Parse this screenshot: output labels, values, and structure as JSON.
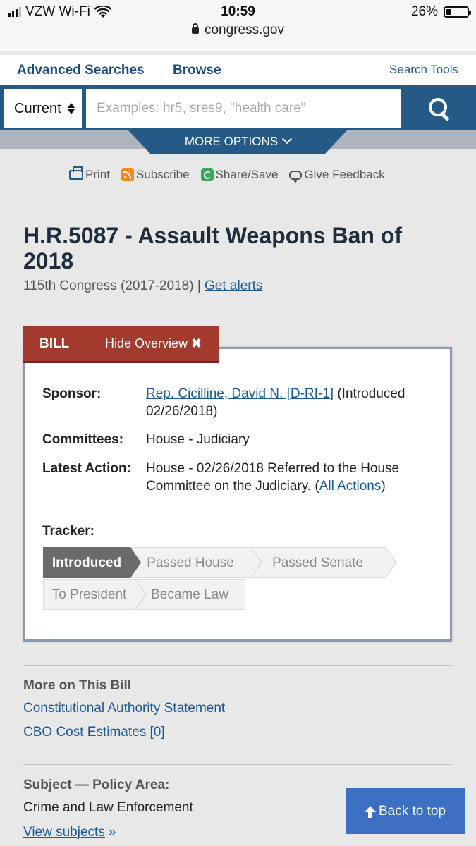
{
  "status_bar": {
    "carrier": "VZW Wi-Fi",
    "time": "10:59",
    "battery": "26%",
    "battery_level": 0.26
  },
  "browser": {
    "url": "congress.gov"
  },
  "nav": {
    "advanced": "Advanced Searches",
    "browse": "Browse",
    "search_tools": "Search Tools"
  },
  "search": {
    "scope": "Current",
    "placeholder": "Examples: hr5, sres9, \"health care\"",
    "more_options": "MORE OPTIONS"
  },
  "utilities": {
    "print": "Print",
    "subscribe": "Subscribe",
    "share": "Share/Save",
    "feedback": "Give Feedback"
  },
  "bill": {
    "title": "H.R.5087 - Assault Weapons Ban of 2018",
    "congress": "115th Congress (2017-2018)",
    "separator": "|",
    "get_alerts": "Get alerts"
  },
  "overview": {
    "tab_label": "BILL",
    "hide_label": "Hide Overview",
    "sponsor_label": "Sponsor:",
    "sponsor_name": "Rep. Cicilline, David N. [D-RI-1]",
    "sponsor_note": " (Introduced 02/26/2018)",
    "committees_label": "Committees:",
    "committees_value": "House - Judiciary",
    "latest_action_label": "Latest Action:",
    "latest_action_value": "House - 02/26/2018 Referred to the House Committee on the Judiciary.",
    "all_actions_open": "(",
    "all_actions": "All Actions",
    "all_actions_close": ")",
    "tracker_label": "Tracker:",
    "tracker_steps": [
      "Introduced",
      "Passed House",
      "Passed Senate",
      "To President",
      "Became Law"
    ],
    "tracker_current": "Introduced"
  },
  "more_on_bill": {
    "heading": "More on This Bill",
    "links": [
      "Constitutional Authority Statement",
      "CBO Cost Estimates [0]"
    ]
  },
  "subject": {
    "heading": "Subject — Policy Area:",
    "value": "Crime and Law Enforcement",
    "view_link": "View subjects"
  },
  "back_to_top": "Back to top"
}
